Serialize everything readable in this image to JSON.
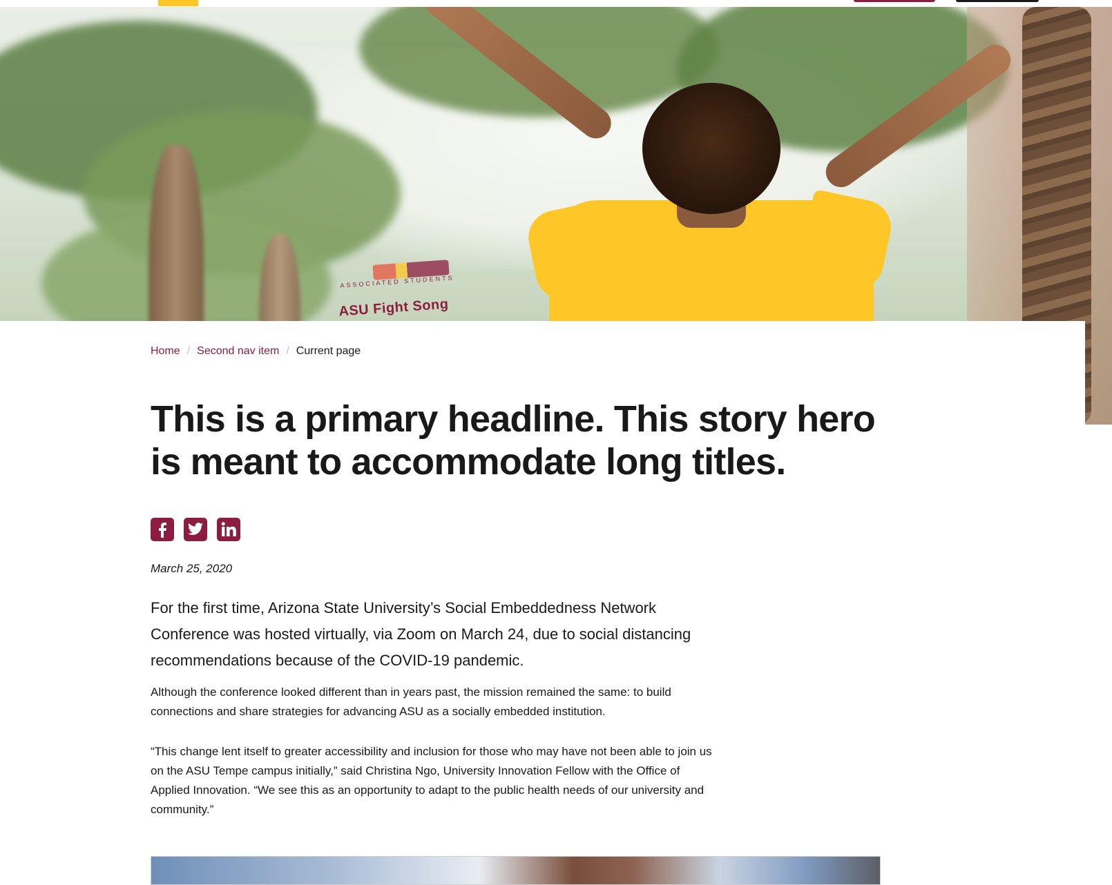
{
  "hero": {
    "shirt_line1": "ASSOCIATED STUDENTS",
    "shirt_line2": "ASU Fight Song"
  },
  "breadcrumb": {
    "items": [
      {
        "label": "Home"
      },
      {
        "label": "Second nav item"
      },
      {
        "label": "Current page"
      }
    ]
  },
  "article": {
    "headline": "This is a primary headline. This story hero is meant to accommodate long titles.",
    "social": [
      {
        "icon": "facebook-icon"
      },
      {
        "icon": "twitter-icon"
      },
      {
        "icon": "linkedin-icon"
      }
    ],
    "date": "March 25, 2020",
    "lede": "For the first time, Arizona State University’s Social Embeddedness Network Conference was hosted virtually, via Zoom on March 24, due to social distancing recommendations because of the COVID-19 pandemic.",
    "paragraphs": [
      "Although the conference looked different than in years past, the mission remained the same: to build connections and share strategies for advancing ASU as a socially embedded institution.",
      "“This change lent itself to greater accessibility and inclusion for those who may have not been able to join us on the ASU Tempe campus initially,” said Christina Ngo, University Innovation Fellow with the Office of Applied Innovation. “We see this as an opportunity to adapt to the public health needs of our university and community.”"
    ]
  },
  "colors": {
    "maroon": "#8c1d40",
    "gold": "#ffc627",
    "text": "#191919"
  }
}
